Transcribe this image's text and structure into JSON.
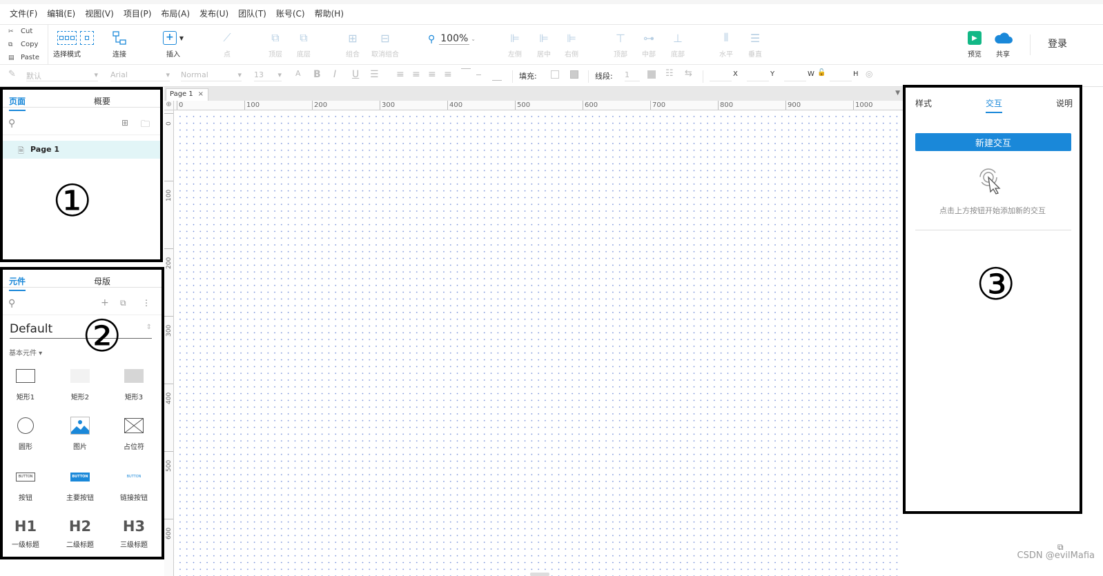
{
  "menu": [
    "文件(F)",
    "编辑(E)",
    "视图(V)",
    "项目(P)",
    "布局(A)",
    "发布(U)",
    "团队(T)",
    "账号(C)",
    "帮助(H)"
  ],
  "clipboard": {
    "cut": "Cut",
    "copy": "Copy",
    "paste": "Paste"
  },
  "toolbar": {
    "select_mode": "选择模式",
    "connect": "连接",
    "insert": "插入",
    "point": "点",
    "top_layer": "顶层",
    "bottom_layer": "底层",
    "group": "组合",
    "ungroup": "取消组合",
    "zoom": "100%",
    "align_left": "左侧",
    "align_center": "居中",
    "align_right": "右侧",
    "align_top": "顶部",
    "align_middle": "中部",
    "align_bottom": "底部",
    "dist_h": "水平",
    "dist_v": "垂直",
    "preview": "预览",
    "share": "共享",
    "login": "登录"
  },
  "format": {
    "style": "默认",
    "font": "Arial",
    "weight": "Normal",
    "size": "13",
    "fill_label": "填充:",
    "line_label": "线段:",
    "line_value": "1",
    "x": "X",
    "y": "Y",
    "w": "W",
    "h": "H"
  },
  "pages_panel": {
    "tabs": [
      "页面",
      "概要"
    ],
    "pages": [
      "Page 1"
    ],
    "marker": "①"
  },
  "widgets_panel": {
    "tabs": [
      "元件",
      "母版"
    ],
    "library": "Default",
    "category": "基本元件 ▾",
    "marker": "②",
    "widgets": [
      {
        "label": "矩形1"
      },
      {
        "label": "矩形2"
      },
      {
        "label": "矩形3"
      },
      {
        "label": "圆形"
      },
      {
        "label": "图片"
      },
      {
        "label": "占位符"
      },
      {
        "label": "按钮",
        "icon_text": "BUTTON"
      },
      {
        "label": "主要按钮",
        "icon_text": "BUTTON"
      },
      {
        "label": "链接按钮",
        "icon_text": "BUTTON"
      },
      {
        "label": "一级标题",
        "icon_text": "H1"
      },
      {
        "label": "二级标题",
        "icon_text": "H2"
      },
      {
        "label": "三级标题",
        "icon_text": "H3"
      }
    ]
  },
  "canvas": {
    "page_tab": "Page 1",
    "ruler_h": [
      "0",
      "100",
      "200",
      "300",
      "400",
      "500",
      "600",
      "700",
      "800",
      "900",
      "1000"
    ],
    "ruler_v": [
      "0",
      "100",
      "200",
      "300",
      "400",
      "500",
      "600"
    ]
  },
  "right_panel": {
    "tabs": [
      "样式",
      "交互",
      "说明"
    ],
    "new_interaction": "新建交互",
    "hint": "点击上方按钮开始添加新的交互",
    "marker": "③"
  },
  "watermark": "CSDN @evilMafia",
  "colors": {
    "accent": "#1a88d9",
    "preview": "#12b886",
    "grid_dot": "#6b87d6"
  }
}
